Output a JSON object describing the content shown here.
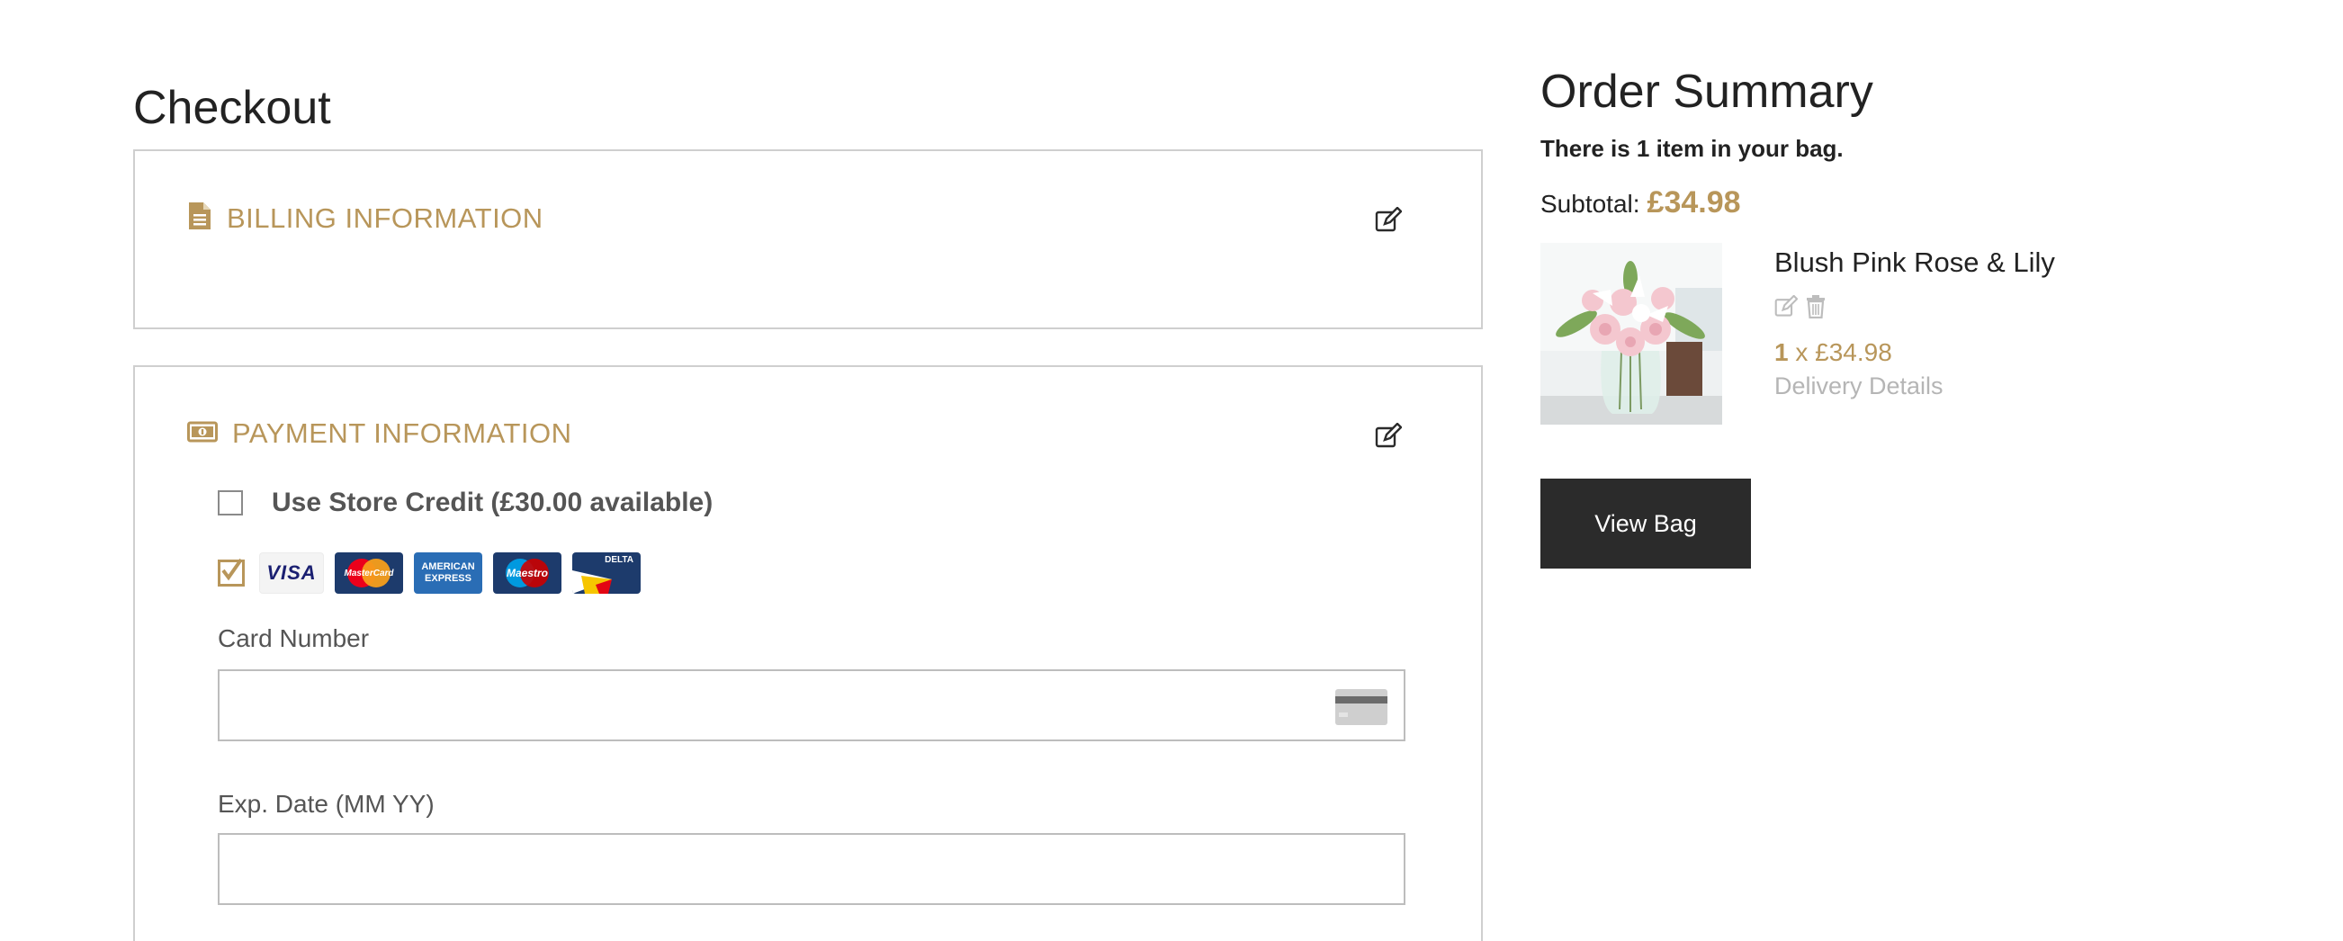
{
  "checkout": {
    "title": "Checkout",
    "billing": {
      "title": "BILLING INFORMATION",
      "icon": "document-icon",
      "edit_icon": "edit-icon"
    },
    "payment": {
      "title": "PAYMENT INFORMATION",
      "icon": "money-icon",
      "edit_icon": "edit-icon",
      "store_credit": {
        "label": "Use Store Credit (£30.00 available)",
        "checked": false
      },
      "card_option_checked": true,
      "card_brands": [
        {
          "name": "visa-logo",
          "label": "VISA"
        },
        {
          "name": "mastercard-logo",
          "label": "MasterCard"
        },
        {
          "name": "american-express-logo",
          "label_1": "AMERICAN",
          "label_2": "EXPRESS"
        },
        {
          "name": "maestro-logo",
          "label": "Maestro"
        },
        {
          "name": "delta-logo",
          "label": "DELTA"
        }
      ],
      "card_number": {
        "label": "Card Number",
        "value": "",
        "icon": "credit-card-icon"
      },
      "exp_date": {
        "label": "Exp. Date (MM YY)",
        "value": ""
      }
    }
  },
  "summary": {
    "title": "Order Summary",
    "bag_count_text": "There is 1 item in your bag.",
    "subtotal_label": "Subtotal:",
    "subtotal_value": "£34.98",
    "item": {
      "name": "Blush Pink Rose & Lily",
      "quantity": "1",
      "times": "x",
      "price": "£34.98",
      "delivery_link": "Delivery Details",
      "action_icons": [
        "edit-icon",
        "trash-icon"
      ]
    },
    "view_bag_label": "View Bag"
  },
  "colors": {
    "accent": "#b8965a",
    "button_bg": "#2b2b2b",
    "border": "#cfcfcf"
  }
}
